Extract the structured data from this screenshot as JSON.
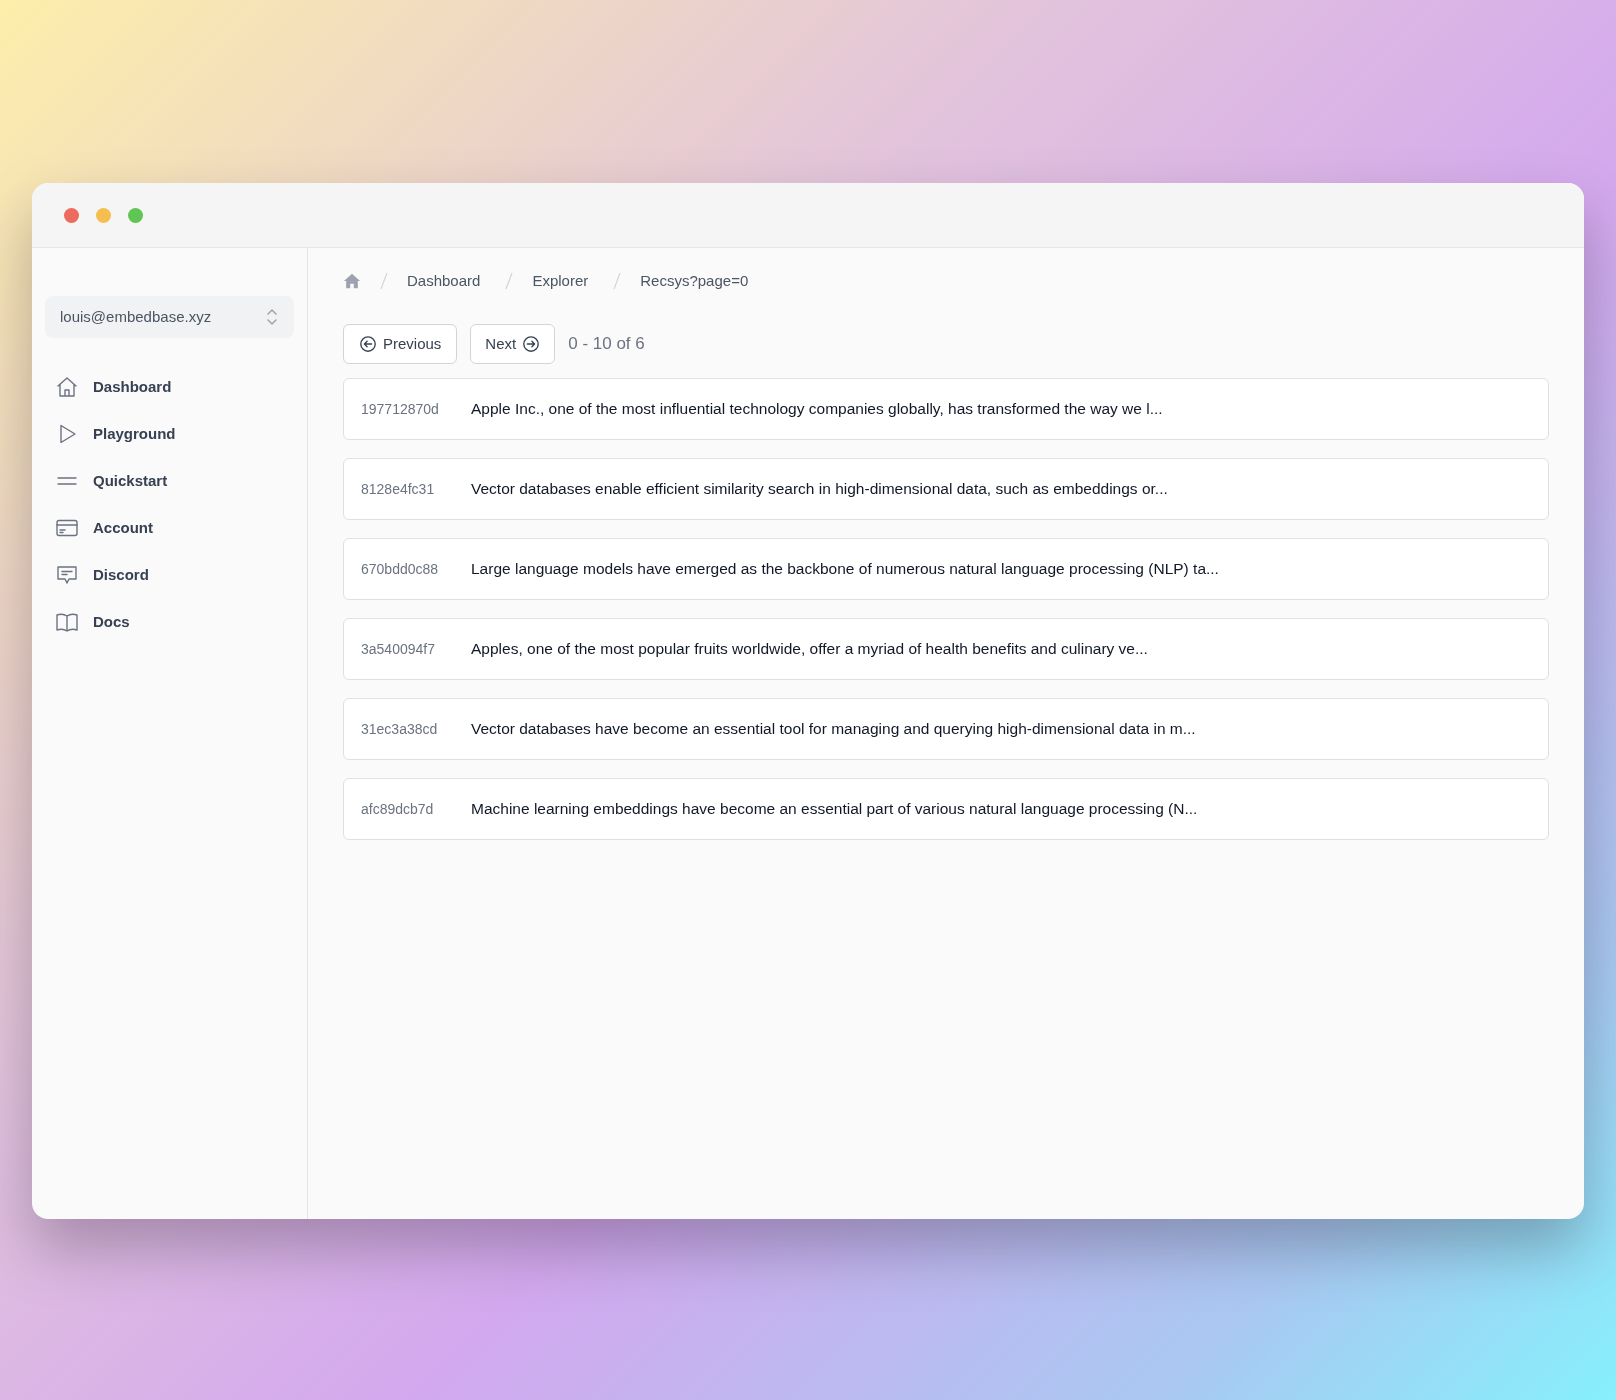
{
  "account_switcher": {
    "value": "louis@embedbase.xyz"
  },
  "sidebar": {
    "items": [
      {
        "label": "Dashboard"
      },
      {
        "label": "Playground"
      },
      {
        "label": "Quickstart"
      },
      {
        "label": "Account"
      },
      {
        "label": "Discord"
      },
      {
        "label": "Docs"
      }
    ]
  },
  "breadcrumb": [
    "Dashboard",
    "Explorer",
    "Recsys?page=0"
  ],
  "pagination": {
    "previous": "Previous",
    "next": "Next",
    "range": "0 - 10 of 6"
  },
  "documents": [
    {
      "id": "197712870d",
      "text": "Apple Inc., one of the most influential technology companies globally, has transformed the way we l..."
    },
    {
      "id": "8128e4fc31",
      "text": "Vector databases enable efficient similarity search in high-dimensional data, such as embeddings or..."
    },
    {
      "id": "670bdd0c88",
      "text": "Large language models have emerged as the backbone of numerous natural language processing (NLP) ta..."
    },
    {
      "id": "3a540094f7",
      "text": "Apples, one of the most popular fruits worldwide, offer a myriad of health benefits and culinary ve..."
    },
    {
      "id": "31ec3a38cd",
      "text": "Vector databases have become an essential tool for managing and querying high-dimensional data in m..."
    },
    {
      "id": "afc89dcb7d",
      "text": "Machine learning embeddings have become an essential part of various natural language processing (N..."
    }
  ]
}
